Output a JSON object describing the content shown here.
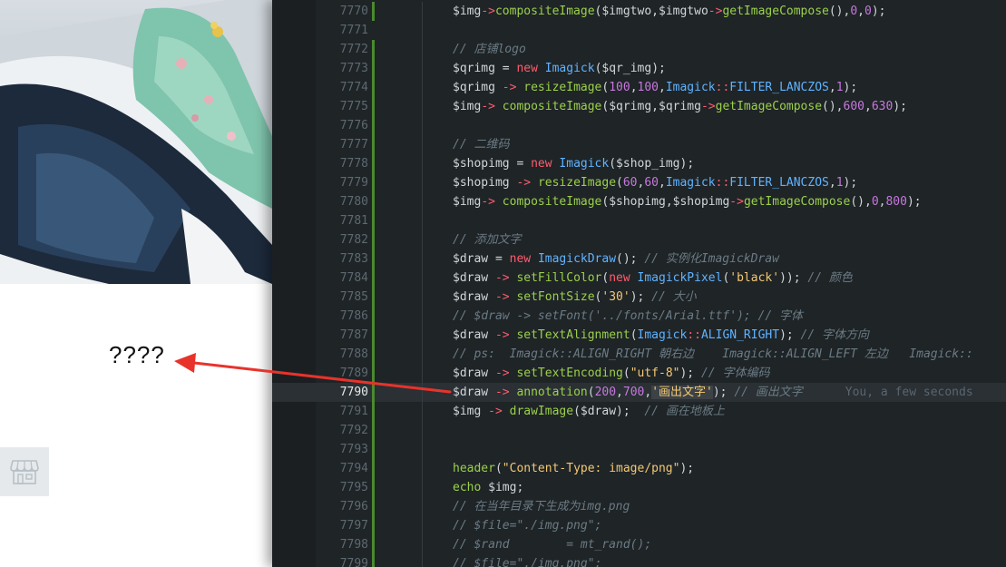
{
  "preview": {
    "output_text": "????"
  },
  "icons": {
    "shop": "shop-icon"
  },
  "editor": {
    "active_line": "7790",
    "lines": [
      {
        "no": "7770",
        "git": true,
        "tokens": [
          [
            "var",
            "$img"
          ],
          [
            "op",
            "->"
          ],
          [
            "fn",
            "compositeImage"
          ],
          [
            "p",
            "("
          ],
          [
            "var",
            "$imgtwo"
          ],
          [
            "p",
            ","
          ],
          [
            "var",
            "$imgtwo"
          ],
          [
            "op",
            "->"
          ],
          [
            "fn",
            "getImageCompose"
          ],
          [
            "p",
            "(),"
          ],
          [
            "num",
            "0"
          ],
          [
            "p",
            ","
          ],
          [
            "num",
            "0"
          ],
          [
            "p",
            ");"
          ]
        ]
      },
      {
        "no": "7771",
        "git": false,
        "tokens": []
      },
      {
        "no": "7772",
        "git": true,
        "tokens": [
          [
            "cmt",
            "// 店铺logo"
          ]
        ]
      },
      {
        "no": "7773",
        "git": true,
        "tokens": [
          [
            "var",
            "$qrimg"
          ],
          [
            "p",
            " = "
          ],
          [
            "new",
            "new "
          ],
          [
            "cls",
            "Imagick"
          ],
          [
            "p",
            "("
          ],
          [
            "var",
            "$qr_img"
          ],
          [
            "p",
            ");"
          ]
        ]
      },
      {
        "no": "7774",
        "git": true,
        "tokens": [
          [
            "var",
            "$qrimg"
          ],
          [
            "p",
            " "
          ],
          [
            "op",
            "->"
          ],
          [
            "p",
            " "
          ],
          [
            "fn",
            "resizeImage"
          ],
          [
            "p",
            "("
          ],
          [
            "num",
            "100"
          ],
          [
            "p",
            ","
          ],
          [
            "num",
            "100"
          ],
          [
            "p",
            ","
          ],
          [
            "cls",
            "Imagick"
          ],
          [
            "op",
            "::"
          ],
          [
            "cls",
            "FILTER_LANCZOS"
          ],
          [
            "p",
            ","
          ],
          [
            "num",
            "1"
          ],
          [
            "p",
            ");"
          ]
        ]
      },
      {
        "no": "7775",
        "git": true,
        "tokens": [
          [
            "var",
            "$img"
          ],
          [
            "op",
            "->"
          ],
          [
            "p",
            " "
          ],
          [
            "fn",
            "compositeImage"
          ],
          [
            "p",
            "("
          ],
          [
            "var",
            "$qrimg"
          ],
          [
            "p",
            ","
          ],
          [
            "var",
            "$qrimg"
          ],
          [
            "op",
            "->"
          ],
          [
            "fn",
            "getImageCompose"
          ],
          [
            "p",
            "(),"
          ],
          [
            "num",
            "600"
          ],
          [
            "p",
            ","
          ],
          [
            "num",
            "630"
          ],
          [
            "p",
            ");"
          ]
        ]
      },
      {
        "no": "7776",
        "git": true,
        "tokens": []
      },
      {
        "no": "7777",
        "git": true,
        "tokens": [
          [
            "cmt",
            "// 二维码"
          ]
        ]
      },
      {
        "no": "7778",
        "git": true,
        "tokens": [
          [
            "var",
            "$shopimg"
          ],
          [
            "p",
            " = "
          ],
          [
            "new",
            "new "
          ],
          [
            "cls",
            "Imagick"
          ],
          [
            "p",
            "("
          ],
          [
            "var",
            "$shop_img"
          ],
          [
            "p",
            ");"
          ]
        ]
      },
      {
        "no": "7779",
        "git": true,
        "tokens": [
          [
            "var",
            "$shopimg"
          ],
          [
            "p",
            " "
          ],
          [
            "op",
            "->"
          ],
          [
            "p",
            " "
          ],
          [
            "fn",
            "resizeImage"
          ],
          [
            "p",
            "("
          ],
          [
            "num",
            "60"
          ],
          [
            "p",
            ","
          ],
          [
            "num",
            "60"
          ],
          [
            "p",
            ","
          ],
          [
            "cls",
            "Imagick"
          ],
          [
            "op",
            "::"
          ],
          [
            "cls",
            "FILTER_LANCZOS"
          ],
          [
            "p",
            ","
          ],
          [
            "num",
            "1"
          ],
          [
            "p",
            ");"
          ]
        ]
      },
      {
        "no": "7780",
        "git": true,
        "tokens": [
          [
            "var",
            "$img"
          ],
          [
            "op",
            "->"
          ],
          [
            "p",
            " "
          ],
          [
            "fn",
            "compositeImage"
          ],
          [
            "p",
            "("
          ],
          [
            "var",
            "$shopimg"
          ],
          [
            "p",
            ","
          ],
          [
            "var",
            "$shopimg"
          ],
          [
            "op",
            "->"
          ],
          [
            "fn",
            "getImageCompose"
          ],
          [
            "p",
            "(),"
          ],
          [
            "num",
            "0"
          ],
          [
            "p",
            ","
          ],
          [
            "num",
            "800"
          ],
          [
            "p",
            ");"
          ]
        ]
      },
      {
        "no": "7781",
        "git": true,
        "tokens": []
      },
      {
        "no": "7782",
        "git": true,
        "tokens": [
          [
            "cmt",
            "// 添加文字"
          ]
        ]
      },
      {
        "no": "7783",
        "git": true,
        "tokens": [
          [
            "var",
            "$draw"
          ],
          [
            "p",
            " = "
          ],
          [
            "new",
            "new "
          ],
          [
            "cls",
            "ImagickDraw"
          ],
          [
            "p",
            "(); "
          ],
          [
            "cmt",
            "// 实例化ImagickDraw"
          ]
        ]
      },
      {
        "no": "7784",
        "git": true,
        "tokens": [
          [
            "var",
            "$draw"
          ],
          [
            "p",
            " "
          ],
          [
            "op",
            "->"
          ],
          [
            "p",
            " "
          ],
          [
            "fn",
            "setFillColor"
          ],
          [
            "p",
            "("
          ],
          [
            "new",
            "new "
          ],
          [
            "cls",
            "ImagickPixel"
          ],
          [
            "p",
            "("
          ],
          [
            "str",
            "'black'"
          ],
          [
            "p",
            "));"
          ],
          [
            "p",
            " "
          ],
          [
            "cmt",
            "// 颜色"
          ]
        ]
      },
      {
        "no": "7785",
        "git": true,
        "tokens": [
          [
            "var",
            "$draw"
          ],
          [
            "p",
            " "
          ],
          [
            "op",
            "->"
          ],
          [
            "p",
            " "
          ],
          [
            "fn",
            "setFontSize"
          ],
          [
            "p",
            "("
          ],
          [
            "str",
            "'30'"
          ],
          [
            "p",
            ");"
          ],
          [
            "p",
            " "
          ],
          [
            "cmt",
            "// 大小"
          ]
        ]
      },
      {
        "no": "7786",
        "git": true,
        "tokens": [
          [
            "cmt",
            "// $draw -> setFont('../fonts/Arial.ttf'); // 字体"
          ]
        ]
      },
      {
        "no": "7787",
        "git": true,
        "tokens": [
          [
            "var",
            "$draw"
          ],
          [
            "p",
            " "
          ],
          [
            "op",
            "->"
          ],
          [
            "p",
            " "
          ],
          [
            "fn",
            "setTextAlignment"
          ],
          [
            "p",
            "("
          ],
          [
            "cls",
            "Imagick"
          ],
          [
            "op",
            "::"
          ],
          [
            "cls",
            "ALIGN_RIGHT"
          ],
          [
            "p",
            ");"
          ],
          [
            "p",
            " "
          ],
          [
            "cmt",
            "// 字体方向"
          ]
        ]
      },
      {
        "no": "7788",
        "git": true,
        "tokens": [
          [
            "cmt",
            "// ps:  Imagick::ALIGN_RIGHT 朝右边    Imagick::ALIGN_LEFT 左边   Imagick::"
          ]
        ]
      },
      {
        "no": "7789",
        "git": true,
        "tokens": [
          [
            "var",
            "$draw"
          ],
          [
            "p",
            " "
          ],
          [
            "op",
            "->"
          ],
          [
            "p",
            " "
          ],
          [
            "fn",
            "setTextEncoding"
          ],
          [
            "p",
            "("
          ],
          [
            "str",
            "\"utf-8\""
          ],
          [
            "p",
            ");"
          ],
          [
            "p",
            " "
          ],
          [
            "cmt",
            "// 字体编码"
          ]
        ]
      },
      {
        "no": "7790",
        "git": true,
        "tokens": [
          [
            "var",
            "$draw"
          ],
          [
            "p",
            " "
          ],
          [
            "op",
            "->"
          ],
          [
            "p",
            " "
          ],
          [
            "fn",
            "annotation"
          ],
          [
            "p",
            "("
          ],
          [
            "num",
            "200"
          ],
          [
            "p",
            ","
          ],
          [
            "num",
            "700"
          ],
          [
            "p",
            ","
          ],
          [
            "strhl",
            "'画出文字'"
          ],
          [
            "p",
            ");"
          ],
          [
            "p",
            " "
          ],
          [
            "cmt",
            "// 画出文字"
          ],
          [
            "p",
            "      "
          ],
          [
            "blame",
            "You, a few seconds"
          ]
        ]
      },
      {
        "no": "7791",
        "git": true,
        "tokens": [
          [
            "var",
            "$img"
          ],
          [
            "p",
            " "
          ],
          [
            "op",
            "->"
          ],
          [
            "p",
            " "
          ],
          [
            "fn",
            "drawImage"
          ],
          [
            "p",
            "("
          ],
          [
            "var",
            "$draw"
          ],
          [
            "p",
            ");"
          ],
          [
            "p",
            "  "
          ],
          [
            "cmt",
            "// 画在地板上"
          ]
        ]
      },
      {
        "no": "7792",
        "git": true,
        "tokens": []
      },
      {
        "no": "7793",
        "git": true,
        "tokens": []
      },
      {
        "no": "7794",
        "git": true,
        "tokens": [
          [
            "fn",
            "header"
          ],
          [
            "p",
            "("
          ],
          [
            "str",
            "\"Content-Type: image/png\""
          ],
          [
            "p",
            ");"
          ]
        ]
      },
      {
        "no": "7795",
        "git": true,
        "tokens": [
          [
            "fn",
            "echo"
          ],
          [
            "p",
            " "
          ],
          [
            "var",
            "$img"
          ],
          [
            "p",
            ";"
          ]
        ]
      },
      {
        "no": "7796",
        "git": true,
        "tokens": [
          [
            "cmt",
            "// 在当年目录下生成为img.png"
          ]
        ]
      },
      {
        "no": "7797",
        "git": true,
        "tokens": [
          [
            "cmt",
            "// $file=\"./img.png\";"
          ]
        ]
      },
      {
        "no": "7798",
        "git": true,
        "tokens": [
          [
            "cmt",
            "// $rand        = mt_rand();"
          ]
        ]
      },
      {
        "no": "7799",
        "git": true,
        "tokens": [
          [
            "cmt",
            "// $file=\"./img.png\";"
          ]
        ]
      }
    ]
  },
  "colors": {
    "editor_bg": "#1f2427",
    "arrow": "#e8332b",
    "git_added": "#4a8a2e"
  }
}
